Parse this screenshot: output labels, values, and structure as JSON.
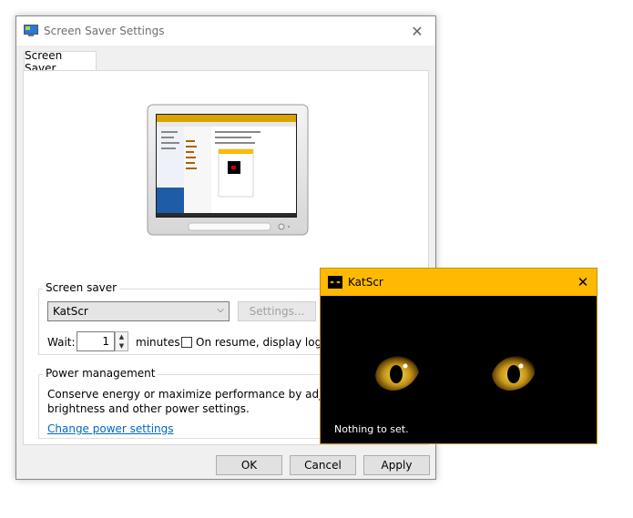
{
  "window": {
    "title": "Screen Saver Settings",
    "tab_label": "Screen Saver"
  },
  "screensaver_group": {
    "label": "Screen saver",
    "selected": "KatScr",
    "settings_button": "Settings...",
    "wait_label": "Wait:",
    "wait_value": "1",
    "minutes_label": "minutes",
    "resume_label": "On resume, display logon",
    "resume_checked": false
  },
  "power_group": {
    "label": "Power management",
    "description_line1": "Conserve energy or maximize performance by adjusting d",
    "description_line2": "brightness and other power settings.",
    "link": "Change power settings"
  },
  "buttons": {
    "ok": "OK",
    "cancel": "Cancel",
    "apply": "Apply"
  },
  "popup": {
    "title": "KatScr",
    "message": "Nothing to set.",
    "accent_color": "#ffb900"
  },
  "icons": [
    "screensaver-app-icon",
    "close-icon",
    "chevron-down-icon",
    "spin-up-icon",
    "spin-down-icon",
    "cat-eyes-icon"
  ]
}
